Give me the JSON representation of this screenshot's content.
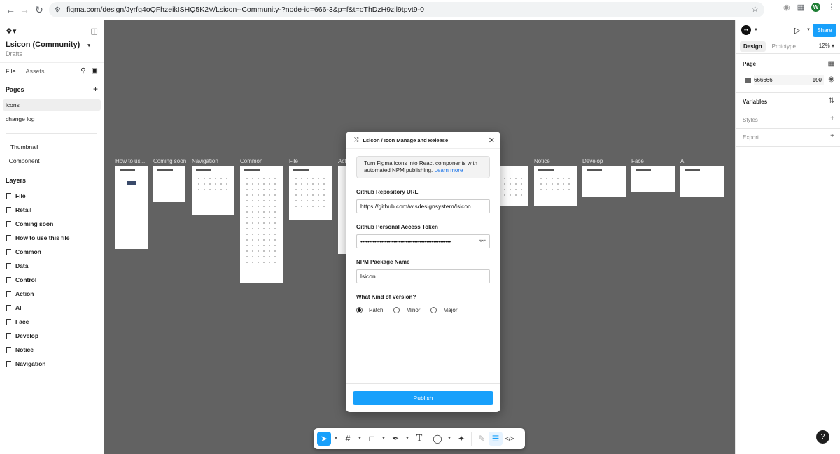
{
  "browser": {
    "url": "figma.com/design/Jyrfg4oQFhzeikISHQ5K2V/Lsicon--Community-?node-id=666-3&p=f&t=oThDzH9zjl9tpvt9-0",
    "avatar_letter": "W"
  },
  "left_panel": {
    "file_title": "Lsicon (Community)",
    "file_subtitle": "Drafts",
    "tabs": [
      "File",
      "Assets"
    ],
    "pages_header": "Pages",
    "pages": [
      "icons",
      "change log",
      "_ Thumbnail",
      "_Component"
    ],
    "layers_header": "Layers",
    "layers": [
      "File",
      "Retail",
      "Coming soon",
      "How to  use this file",
      "Common",
      "Data",
      "Control",
      "Action",
      "AI",
      "Face",
      "Develop",
      "Notice",
      "Navigation"
    ]
  },
  "canvas": {
    "background": "#626262",
    "frame_labels": [
      "How to  us...",
      "Coming soon",
      "Navigation",
      "Common",
      "File",
      "Act",
      "Notice",
      "Develop",
      "Face",
      "AI"
    ]
  },
  "plugin": {
    "title": "Lsicon / Icon Manage and Release",
    "info_text": "Turn Figma icons into React components with automated NPM publishing.",
    "info_link": "Learn more",
    "repo_label": "Github Repository URL",
    "repo_value": "https://github.com/wisdesignsystem/lsicon",
    "token_label": "Github Personal Access Token",
    "token_value": "••••••••••••••••••••••••••••••••••••••••••••••••••••",
    "package_label": "NPM Package Name",
    "package_value": "lsicon",
    "version_label": "What Kind of Version?",
    "version_options": [
      "Patch",
      "Minor",
      "Major"
    ],
    "selected_version": "Patch",
    "publish_label": "Publish"
  },
  "right_panel": {
    "share_label": "Share",
    "tabs": [
      "Design",
      "Prototype"
    ],
    "zoom": "12%",
    "page_label": "Page",
    "page_color": "666666",
    "page_opacity": "100",
    "opacity_unit": "%",
    "variables_label": "Variables",
    "styles_label": "Styles",
    "export_label": "Export"
  },
  "help_label": "?",
  "colors": {
    "accent": "#18a0fb",
    "canvas": "#626262"
  }
}
